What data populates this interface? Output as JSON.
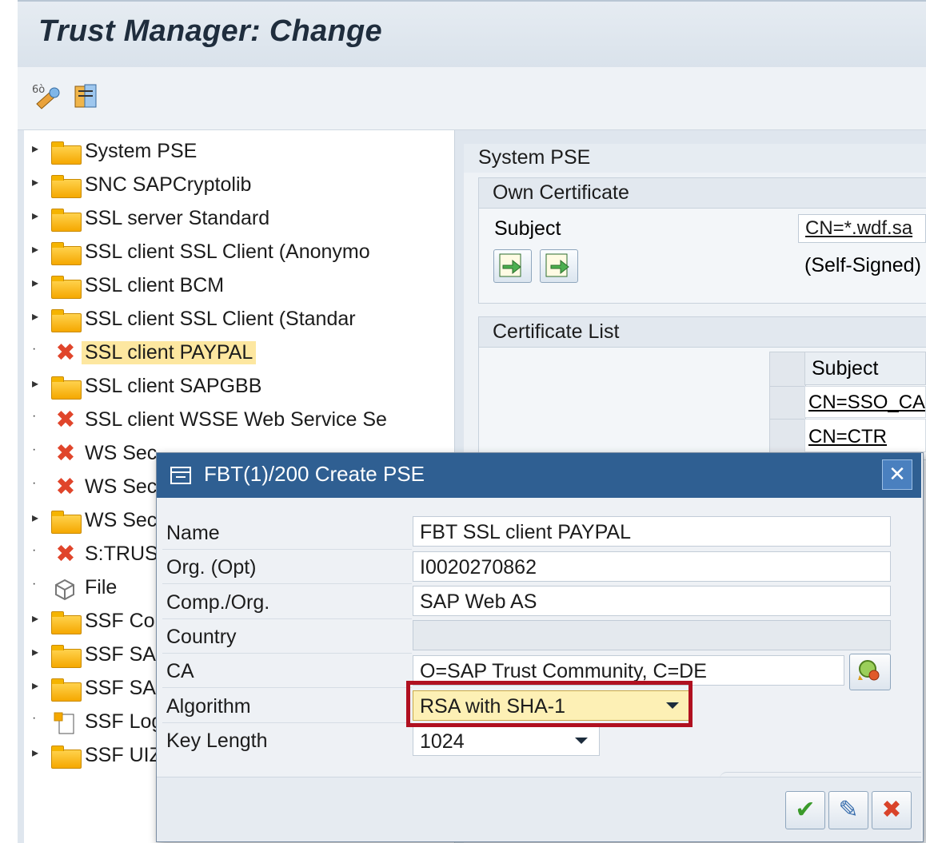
{
  "window": {
    "title": "Trust Manager: Change"
  },
  "toolbar": {
    "icons": [
      "display-change-icon",
      "properties-icon"
    ]
  },
  "tree": {
    "items": [
      {
        "label": "System PSE",
        "icon": "folder-icon",
        "expandable": true
      },
      {
        "label": "SNC SAPCryptolib",
        "icon": "folder-icon",
        "expandable": true
      },
      {
        "label": "SSL server Standard",
        "icon": "folder-icon",
        "expandable": true
      },
      {
        "label": "SSL client SSL Client (Anonymo",
        "icon": "folder-icon",
        "expandable": true
      },
      {
        "label": "SSL client BCM",
        "icon": "folder-icon",
        "expandable": true
      },
      {
        "label": "SSL client SSL Client (Standar",
        "icon": "folder-icon",
        "expandable": true
      },
      {
        "label": "SSL client PAYPAL",
        "icon": "error-x-icon",
        "expandable": false,
        "selected": true
      },
      {
        "label": "SSL client SAPGBB",
        "icon": "folder-icon",
        "expandable": true
      },
      {
        "label": "SSL client WSSE Web Service Se",
        "icon": "error-x-icon",
        "expandable": false
      },
      {
        "label": "WS Sec",
        "icon": "error-x-icon",
        "expandable": false
      },
      {
        "label": "WS Sec",
        "icon": "error-x-icon",
        "expandable": false
      },
      {
        "label": "WS Sec",
        "icon": "folder-icon",
        "expandable": true
      },
      {
        "label": "S:TRUS",
        "icon": "error-x-icon",
        "expandable": false
      },
      {
        "label": "File",
        "icon": "file-icon",
        "expandable": false
      },
      {
        "label": "SSF Col",
        "icon": "folder-icon",
        "expandable": true
      },
      {
        "label": "SSF SAI",
        "icon": "folder-icon",
        "expandable": true
      },
      {
        "label": "SSF SAI",
        "icon": "folder-icon",
        "expandable": true
      },
      {
        "label": "SSF Log",
        "icon": "log-icon",
        "expandable": false
      },
      {
        "label": "SSF UIZ",
        "icon": "folder-icon",
        "expandable": true
      }
    ]
  },
  "detail": {
    "section_title": "System PSE",
    "own_cert": {
      "title": "Own Certificate",
      "subject_label": "Subject",
      "subject_value": "CN=*.wdf.sa",
      "signed_text": "(Self-Signed)"
    },
    "cert_list": {
      "title": "Certificate List",
      "col_subject": "Subject",
      "rows": [
        "CN=SSO_CA",
        "CN=CTR"
      ]
    }
  },
  "dialog": {
    "title": "FBT(1)/200 Create PSE",
    "fields": {
      "name": {
        "label": "Name",
        "value": "FBT SSL client PAYPAL"
      },
      "org": {
        "label": "Org. (Opt)",
        "value": "I0020270862"
      },
      "comp_org": {
        "label": "Comp./Org.",
        "value": "SAP Web AS"
      },
      "country": {
        "label": "Country",
        "value": ""
      },
      "ca": {
        "label": "CA",
        "value": "O=SAP Trust Community, C=DE"
      },
      "algorithm": {
        "label": "Algorithm",
        "value": "RSA with SHA-1"
      },
      "key_length": {
        "label": "Key Length",
        "value": "1024"
      }
    },
    "buttons": {
      "ok": "✔",
      "edit": "✎",
      "cancel": "✖"
    }
  },
  "colors": {
    "highlight_box": "#b01020",
    "dialog_title_bg": "#2f5f92",
    "selected_row_bg": "#fde7a0"
  }
}
